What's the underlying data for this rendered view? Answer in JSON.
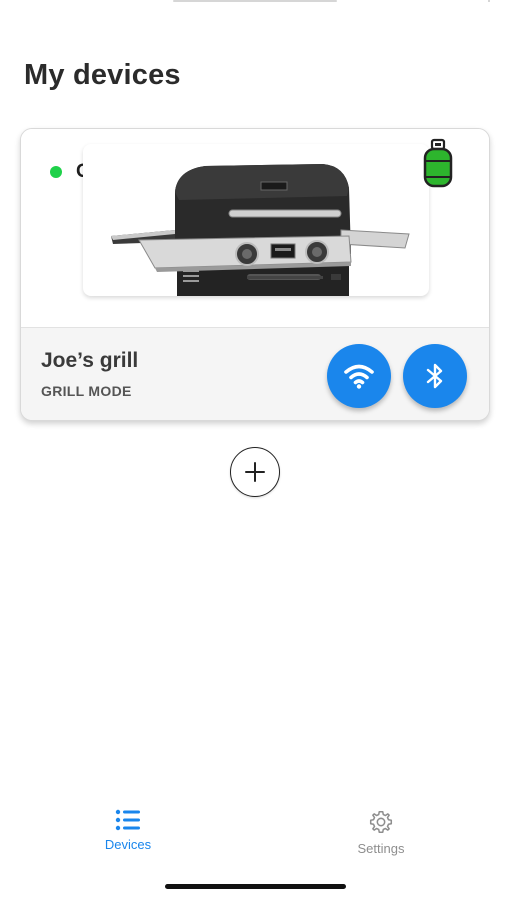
{
  "page": {
    "title": "My devices"
  },
  "device": {
    "status": "ON",
    "name": "Joe’s grill",
    "mode": "GRILL MODE",
    "fuel": {
      "icon": "propane-tank-icon",
      "color": "#2db52d"
    },
    "connections": {
      "wifi_icon": "wifi-icon",
      "bluetooth_icon": "bluetooth-icon"
    }
  },
  "actions": {
    "add_icon": "plus-icon"
  },
  "tabs": [
    {
      "label": "Devices",
      "icon": "list-icon",
      "active": true
    },
    {
      "label": "Settings",
      "icon": "gear-icon",
      "active": false
    }
  ],
  "colors": {
    "accent": "#1a86ec",
    "status_on": "#1fd14a",
    "inactive": "#8e8e8e"
  }
}
